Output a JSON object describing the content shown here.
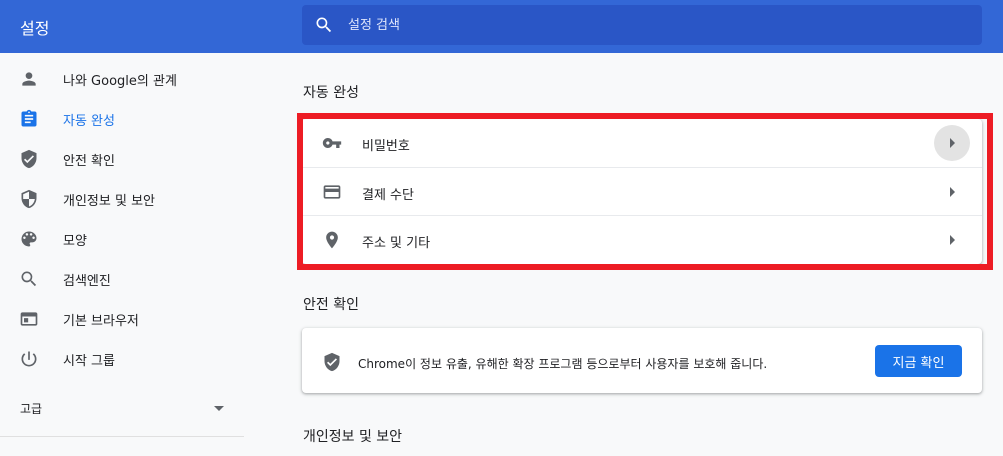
{
  "header": {
    "title": "설정",
    "search_placeholder": "설정 검색"
  },
  "sidebar": {
    "items": [
      {
        "label": "나와 Google의 관계",
        "icon": "person-icon"
      },
      {
        "label": "자동 완성",
        "icon": "clipboard-icon",
        "active": true
      },
      {
        "label": "안전 확인",
        "icon": "shield-check-icon"
      },
      {
        "label": "개인정보 및 보안",
        "icon": "shield-icon"
      },
      {
        "label": "모양",
        "icon": "palette-icon"
      },
      {
        "label": "검색엔진",
        "icon": "search-icon"
      },
      {
        "label": "기본 브라우저",
        "icon": "browser-icon"
      },
      {
        "label": "시작 그룹",
        "icon": "power-icon"
      }
    ],
    "advanced_label": "고급"
  },
  "main": {
    "autofill": {
      "title": "자동 완성",
      "rows": [
        {
          "label": "비밀번호",
          "icon": "key-icon"
        },
        {
          "label": "결제 수단",
          "icon": "credit-card-icon"
        },
        {
          "label": "주소 및 기타",
          "icon": "location-pin-icon"
        }
      ]
    },
    "safety": {
      "title": "안전 확인",
      "text": "Chrome이 정보 유출, 유해한 확장 프로그램 등으로부터 사용자를 보호해 줍니다.",
      "button_label": "지금 확인"
    },
    "privacy": {
      "title": "개인정보 및 보안"
    }
  },
  "colors": {
    "header_bg": "#3367d6",
    "accent": "#1a73e8",
    "highlight_border": "#ed1c24"
  }
}
